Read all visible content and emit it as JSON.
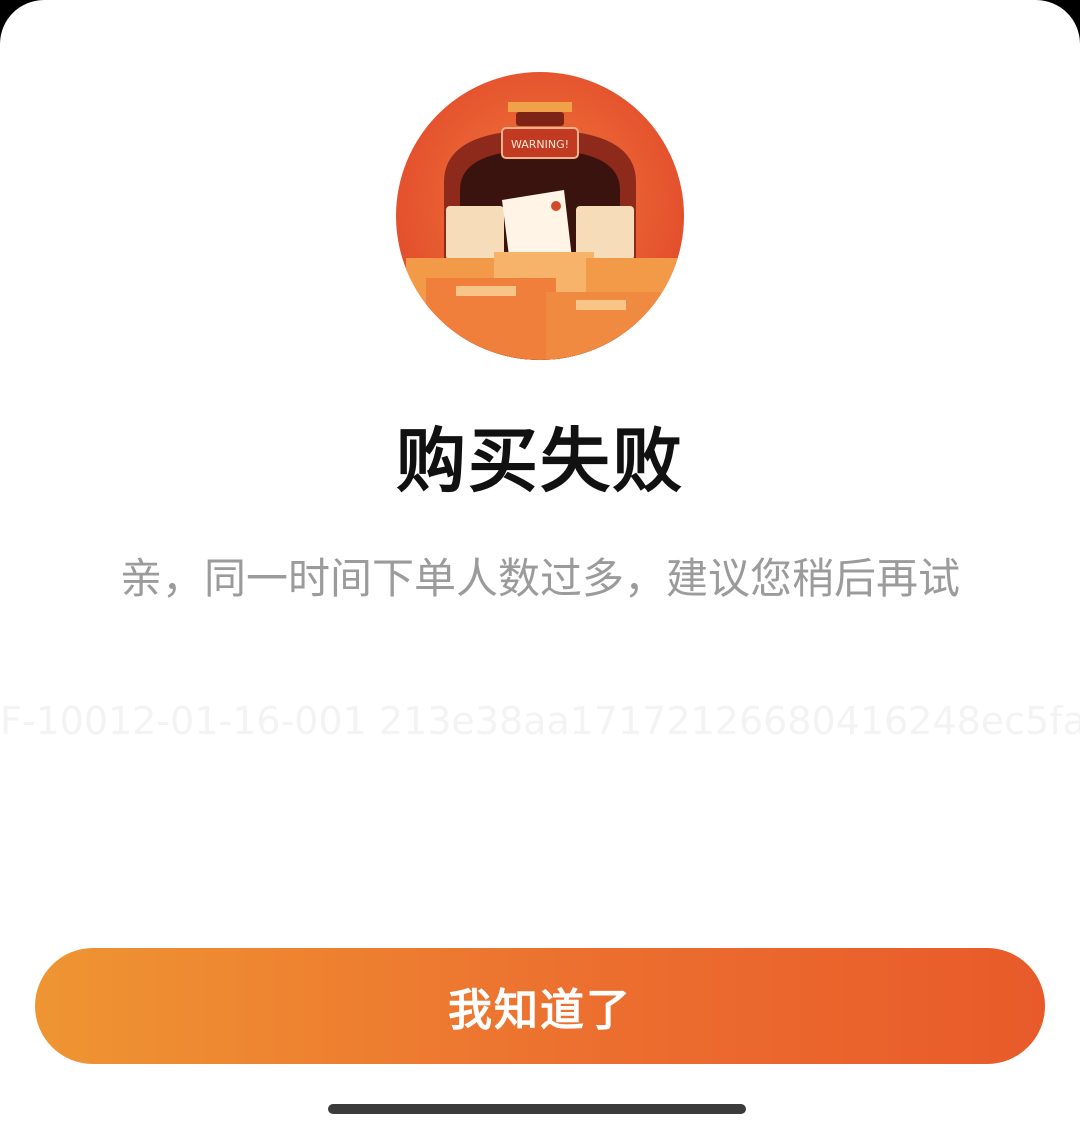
{
  "dialog": {
    "illustration": {
      "icon": "warning-parcel-illustration",
      "sign_text": "WARNING!"
    },
    "title": "购买失败",
    "message": "亲，同一时间下单人数过多，建议您稍后再试",
    "error_code": "F-10012-01-16-001 213e38aa17172126680416248ec5fa",
    "confirm_label": "我知道了"
  },
  "colors": {
    "accent_start": "#ef9532",
    "accent_end": "#e85a2a",
    "illustration_red": "#e4532c"
  }
}
